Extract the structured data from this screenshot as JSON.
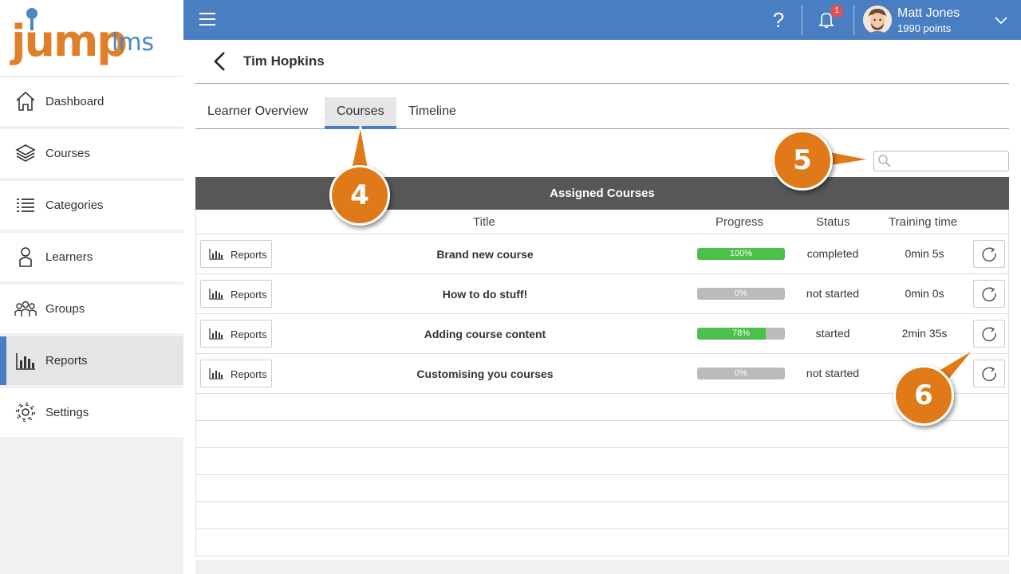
{
  "sidebar": {
    "logo_main": "jump",
    "logo_suffix": "lms",
    "items": [
      {
        "label": "Dashboard",
        "icon": "home-icon"
      },
      {
        "label": "Courses",
        "icon": "stack-icon"
      },
      {
        "label": "Categories",
        "icon": "list-icon"
      },
      {
        "label": "Learners",
        "icon": "person-icon"
      },
      {
        "label": "Groups",
        "icon": "group-icon"
      },
      {
        "label": "Reports",
        "icon": "bar-chart-icon",
        "active": true
      },
      {
        "label": "Settings",
        "icon": "gear-icon"
      }
    ]
  },
  "header": {
    "help": "?",
    "notification_count": "1",
    "user_name": "Matt Jones",
    "user_points": "1990 points",
    "accent": "#4a7ec2"
  },
  "page": {
    "title": "Tim Hopkins",
    "tabs": [
      "Learner Overview",
      "Courses",
      "Timeline"
    ],
    "active_tab": "Courses",
    "search_value": ""
  },
  "table": {
    "caption": "Assigned Courses",
    "columns": [
      "Title",
      "Progress",
      "Status",
      "Training time"
    ],
    "reports_label": "Reports",
    "rows": [
      {
        "title": "Brand new course",
        "progress": 100,
        "progress_label": "100%",
        "status": "completed",
        "time": "0min 5s"
      },
      {
        "title": "How to do stuff!",
        "progress": 0,
        "progress_label": "0%",
        "status": "not started",
        "time": "0min 0s"
      },
      {
        "title": "Adding course content",
        "progress": 78,
        "progress_label": "78%",
        "status": "started",
        "time": "2min 35s"
      },
      {
        "title": "Customising you courses",
        "progress": 0,
        "progress_label": "0%",
        "status": "not started",
        "time": ""
      }
    ]
  },
  "callouts": [
    "4",
    "5",
    "6"
  ]
}
